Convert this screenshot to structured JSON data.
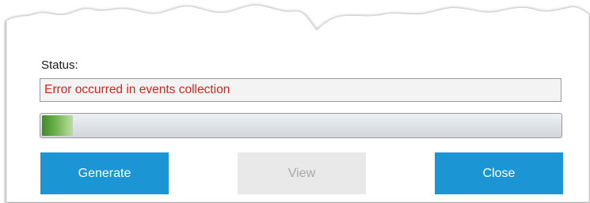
{
  "status": {
    "label": "Status:",
    "message": "Error occurred in events collection",
    "message_color": "#e0211a"
  },
  "progress": {
    "value_percent": 6
  },
  "buttons": {
    "generate_label": "Generate",
    "view_label": "View",
    "view_enabled": false,
    "close_label": "Close",
    "accent_color": "#1b95d3"
  }
}
